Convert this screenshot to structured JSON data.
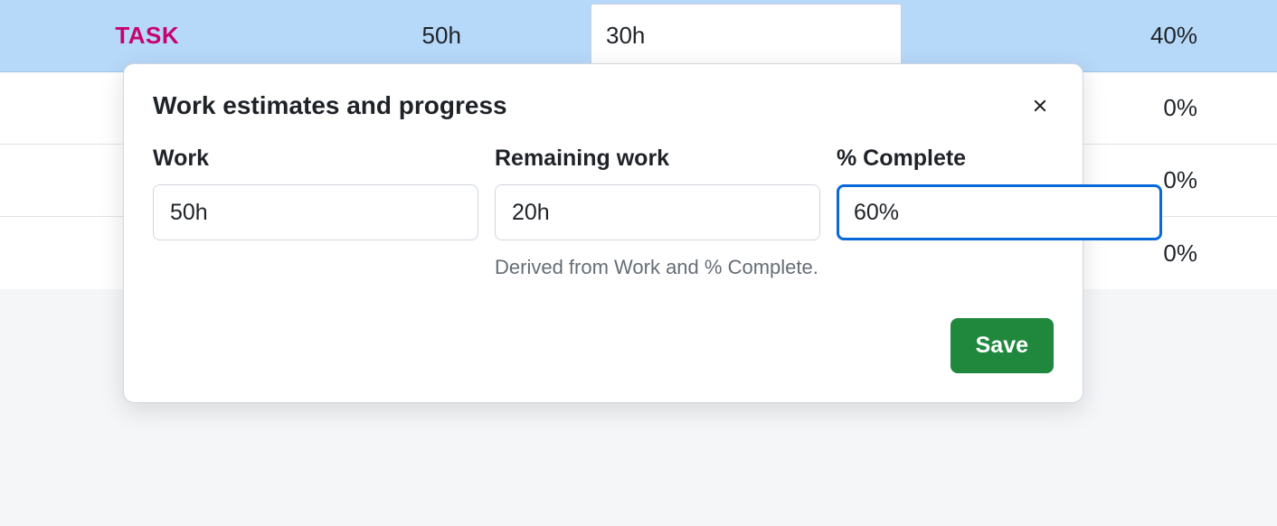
{
  "table": {
    "rows": [
      {
        "task": "TASK",
        "work": "50h",
        "remaining": "30h",
        "pct": "40%",
        "selected": true,
        "editingRemaining": true
      },
      {
        "task": "",
        "work": "",
        "remaining": "",
        "pct": "0%",
        "selected": false
      },
      {
        "task": "",
        "work": "",
        "remaining": "",
        "pct": "0%",
        "selected": false
      },
      {
        "task": "",
        "work": "",
        "remaining": "",
        "pct": "0%",
        "selected": false
      }
    ]
  },
  "dialog": {
    "title": "Work estimates and progress",
    "fields": {
      "work": {
        "label": "Work",
        "value": "50h"
      },
      "remaining": {
        "label": "Remaining work",
        "value": "20h",
        "help": "Derived from Work and % Complete."
      },
      "pct": {
        "label": "% Complete",
        "value": "60%"
      }
    },
    "save": "Save"
  }
}
